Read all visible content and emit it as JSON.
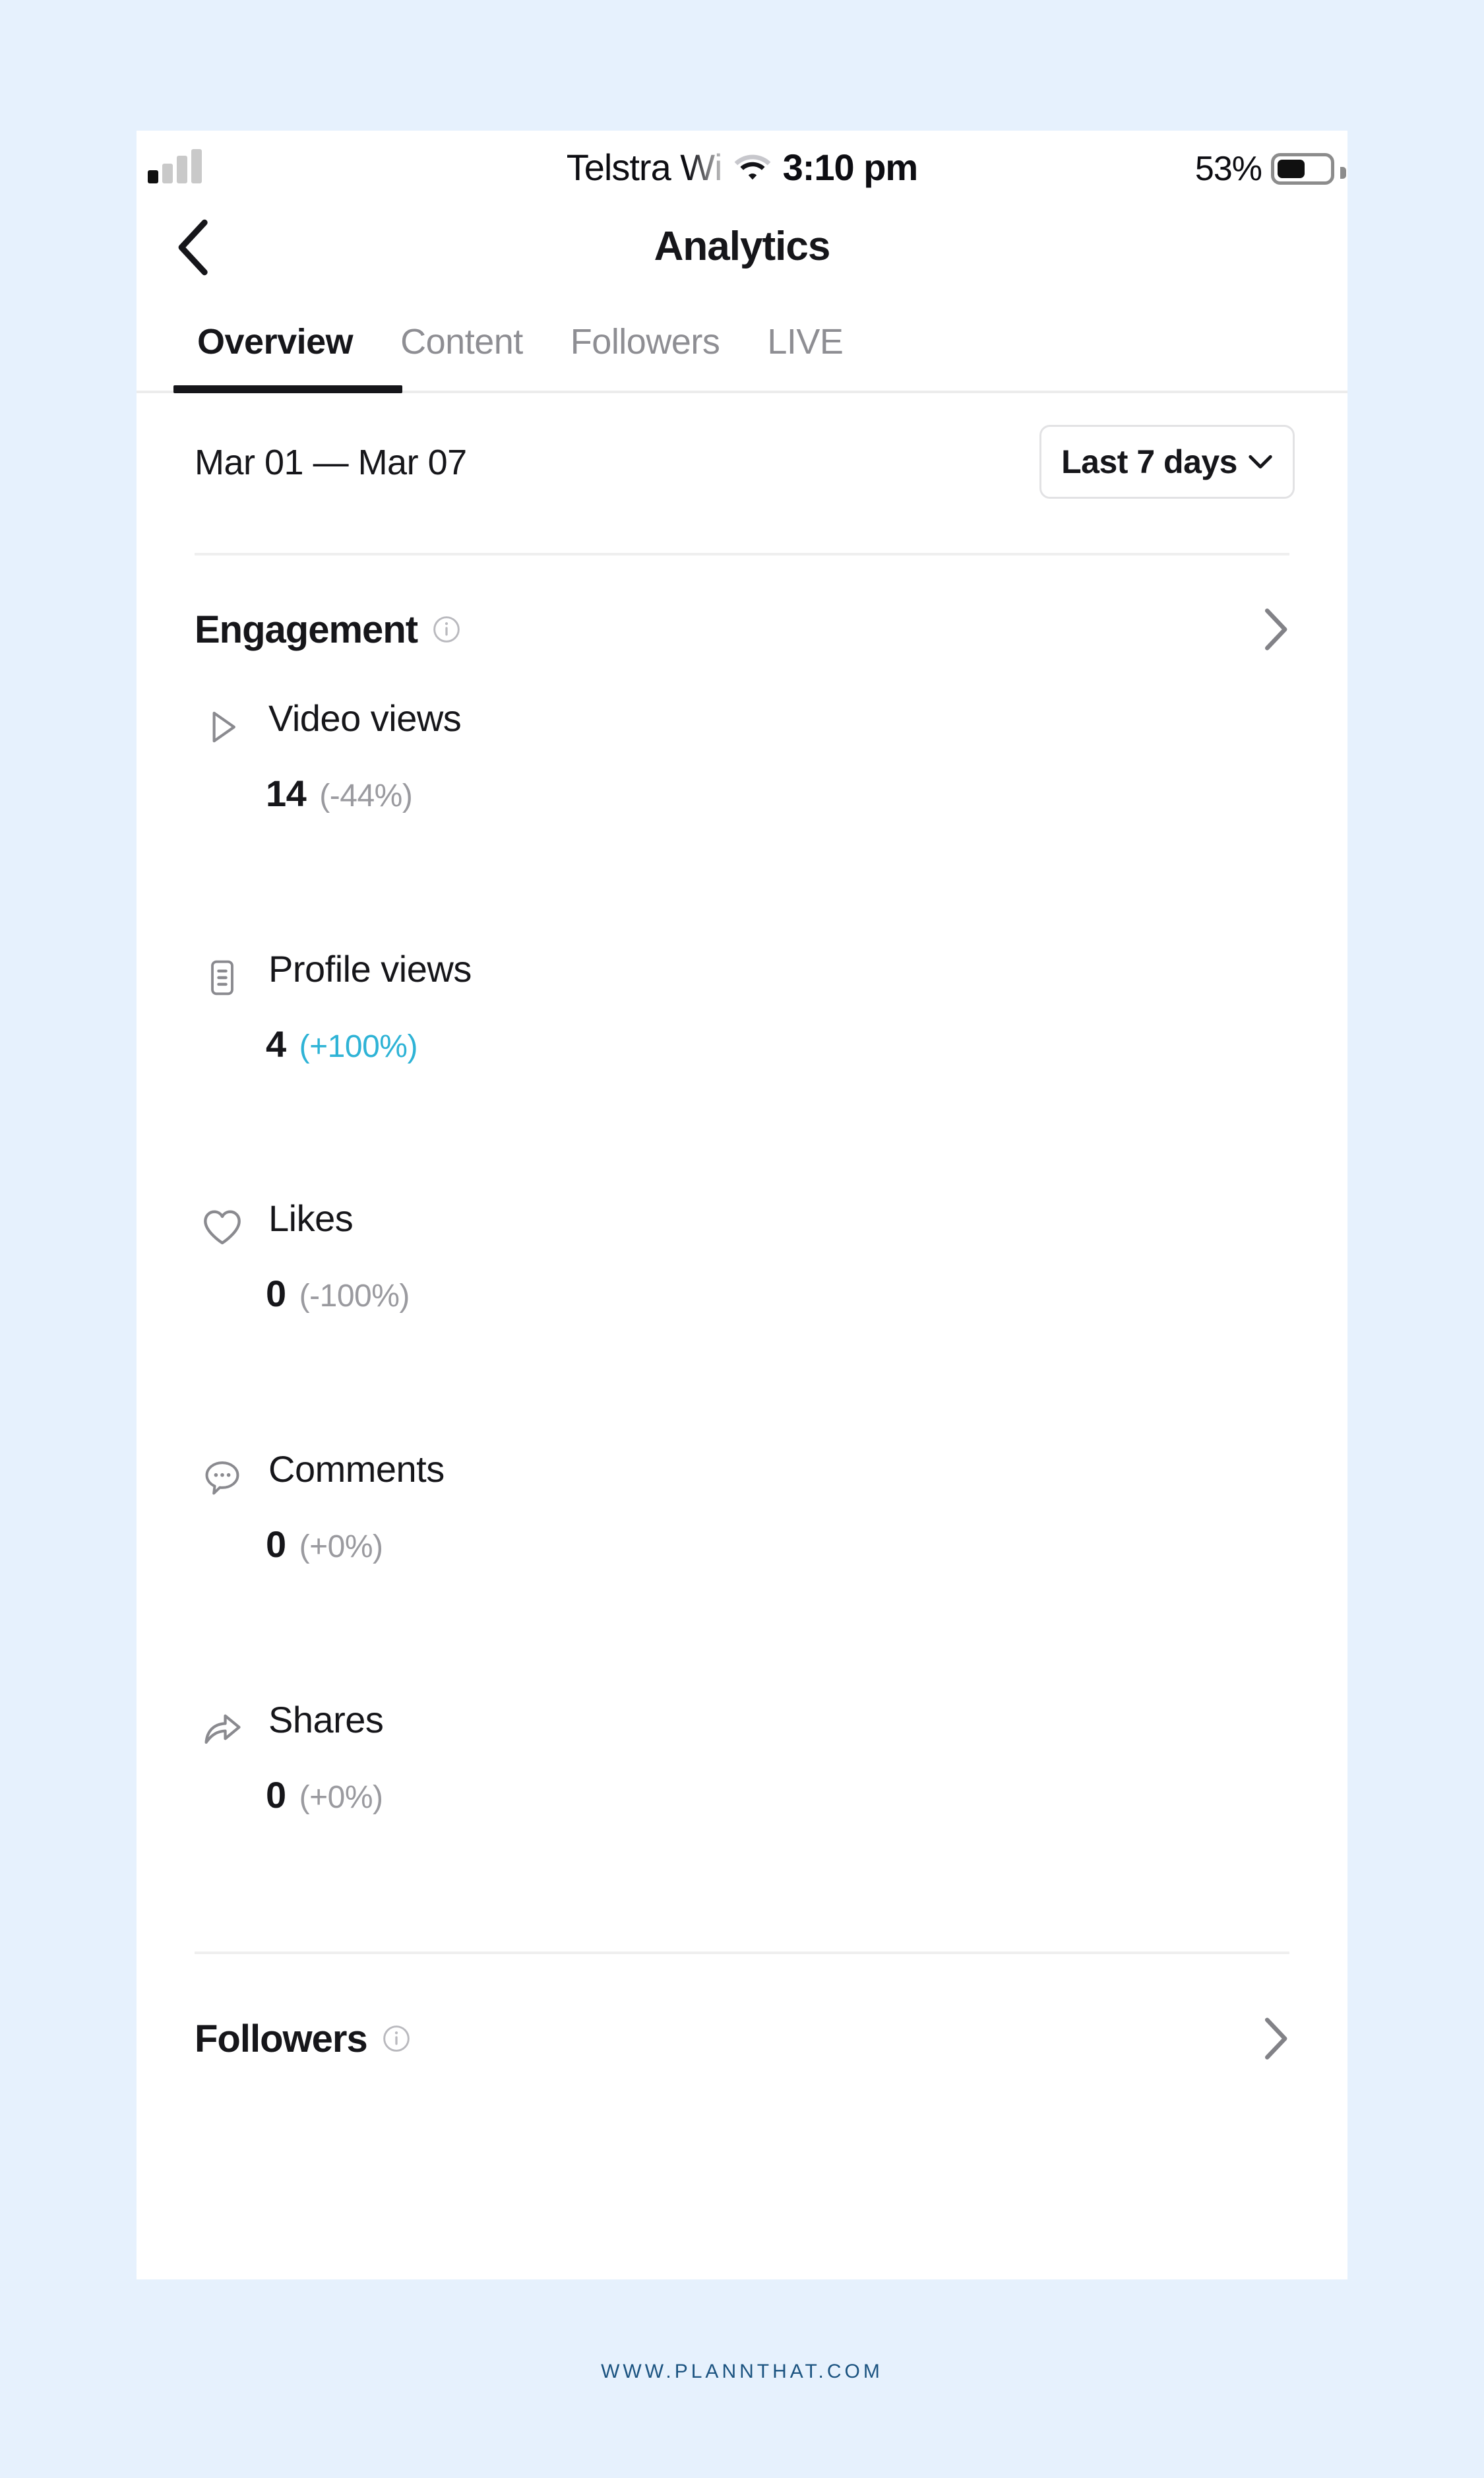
{
  "theme": {
    "page_bg": "#e6f1fd",
    "panel_bg": "#ffffff",
    "text_primary": "#16161a",
    "text_muted": "#8e8e93",
    "delta_negative": "#9a9a9f",
    "delta_positive": "#2eb3d6",
    "divider": "#efefef",
    "watermark": "#1b5380"
  },
  "status_bar": {
    "carrier": "Telstra Wi",
    "wifi_icon": "wifi-icon",
    "time": "3:10 pm",
    "battery_percent": "53%",
    "battery_level": 53,
    "signal_bars_total": 4,
    "signal_bars_active": 1
  },
  "nav": {
    "back_icon": "chevron-left-icon",
    "title": "Analytics"
  },
  "tabs": [
    {
      "label": "Overview",
      "active": true
    },
    {
      "label": "Content",
      "active": false
    },
    {
      "label": "Followers",
      "active": false
    },
    {
      "label": "LIVE",
      "active": false
    }
  ],
  "date_range": {
    "range_text": "Mar 01 — Mar 07",
    "selector_label": "Last 7 days",
    "selector_icon": "chevron-down-icon"
  },
  "sections": {
    "engagement": {
      "title": "Engagement",
      "info_icon": "info-circle-icon",
      "chevron_icon": "chevron-right-icon"
    },
    "followers": {
      "title": "Followers",
      "info_icon": "info-circle-icon",
      "chevron_icon": "chevron-right-icon"
    }
  },
  "metrics": [
    {
      "icon": "play-triangle-icon",
      "label": "Video views",
      "value": "14",
      "delta": "(-44%)",
      "delta_direction": "down"
    },
    {
      "icon": "profile-card-icon",
      "label": "Profile views",
      "value": "4",
      "delta": "(+100%)",
      "delta_direction": "up"
    },
    {
      "icon": "heart-icon",
      "label": "Likes",
      "value": "0",
      "delta": "(-100%)",
      "delta_direction": "down"
    },
    {
      "icon": "comment-bubble-icon",
      "label": "Comments",
      "value": "0",
      "delta": "(+0%)",
      "delta_direction": "down"
    },
    {
      "icon": "share-arrow-icon",
      "label": "Shares",
      "value": "0",
      "delta": "(+0%)",
      "delta_direction": "down"
    }
  ],
  "footer": {
    "watermark": "WWW.PLANNTHAT.COM"
  }
}
